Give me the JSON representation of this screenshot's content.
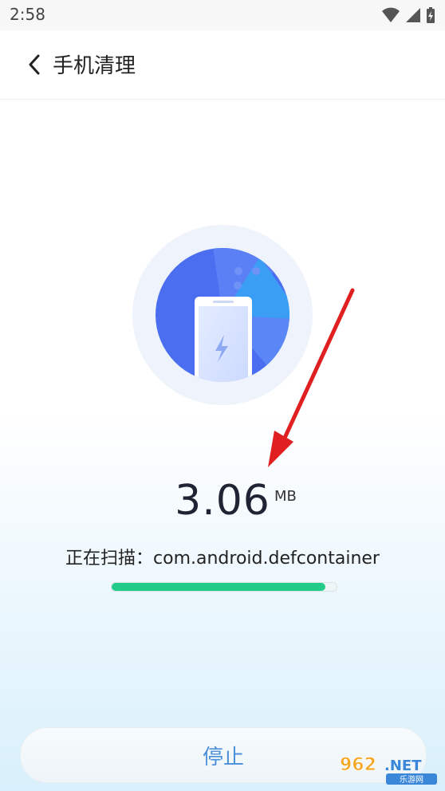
{
  "status_bar": {
    "time": "2:58"
  },
  "header": {
    "title": "手机清理"
  },
  "scan": {
    "size_value": "3.06",
    "size_unit": "MB",
    "status_text": "正在扫描：com.android.defcontainer",
    "progress_fraction": 0.95
  },
  "actions": {
    "stop_label": "停止"
  },
  "watermark": {
    "text": "962.NET",
    "sub": "乐游网"
  },
  "colors": {
    "accent_green": "#22cc88",
    "disc_blue": "#4b6ef0",
    "stop_text": "#4a8fd8",
    "arrow_red": "#e02020"
  }
}
